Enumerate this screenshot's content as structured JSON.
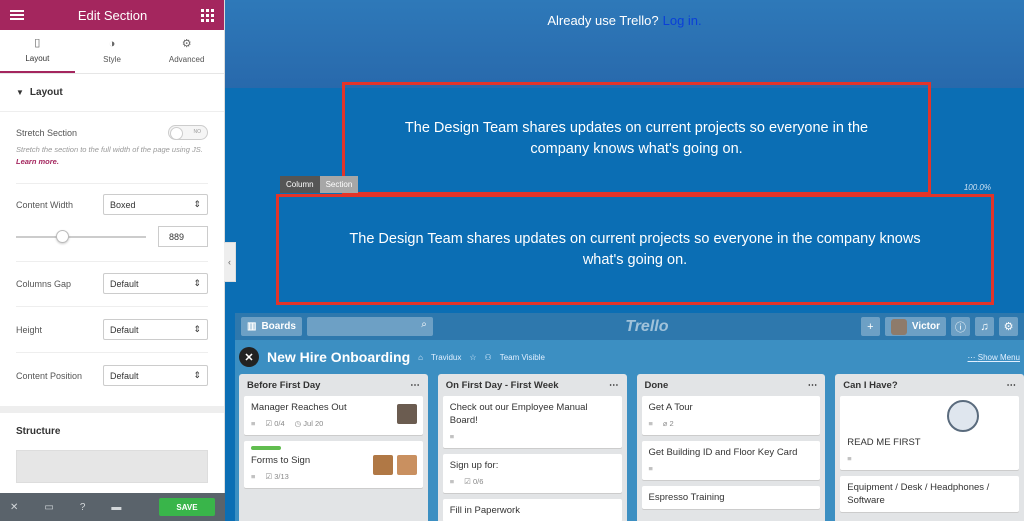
{
  "editor": {
    "title": "Edit Section",
    "tabs": [
      {
        "label": "Layout",
        "icon": "layout-icon"
      },
      {
        "label": "Style",
        "icon": "half-circle-icon"
      },
      {
        "label": "Advanced",
        "icon": "gear-icon"
      }
    ],
    "layout_section_title": "Layout",
    "stretch_label": "Stretch Section",
    "stretch_toggle": "NO",
    "stretch_hint": "Stretch the section to the full width of the page using JS.",
    "learn_more": "Learn more.",
    "content_width_label": "Content Width",
    "content_width_value": "Boxed",
    "slider_value": "889",
    "slider_fraction": 0.35,
    "columns_gap_label": "Columns Gap",
    "columns_gap_value": "Default",
    "height_label": "Height",
    "height_value": "Default",
    "content_position_label": "Content Position",
    "content_position_value": "Default",
    "structure_title": "Structure",
    "save_label": "SAVE"
  },
  "page": {
    "top_text": "Already use Trello?",
    "login_link": "Log in.",
    "text_block_1": "The Design Team shares updates on current projects so everyone in the company knows what's going on.",
    "text_block_2": "The Design Team shares updates on current projects so everyone in the company knows what's going on.",
    "column_badge": "Column",
    "section_badge": "Section",
    "width_percent": "100.0%",
    "accent_color": "#e3342a"
  },
  "trello": {
    "boards_label": "Boards",
    "logo": "Trello",
    "user": "Victor",
    "board_title": "New Hire Onboarding",
    "team": "Travidux",
    "visibility": "Team Visible",
    "show_menu": "Show Menu",
    "lists": [
      {
        "name": "Before First Day",
        "cards": [
          {
            "title": "Manager Reaches Out",
            "checklist": "0/4",
            "due": "Jul 20"
          },
          {
            "title": "Forms to Sign",
            "checklist": "3/13"
          }
        ]
      },
      {
        "name": "On First Day - First Week",
        "cards": [
          {
            "title": "Check out our Employee Manual Board!"
          },
          {
            "title": "Sign up for:",
            "checklist": "0/6"
          },
          {
            "title": "Fill in Paperwork"
          }
        ]
      },
      {
        "name": "Done",
        "cards": [
          {
            "title": "Get A Tour",
            "attachments": "2"
          },
          {
            "title": "Get Building ID and Floor Key Card"
          },
          {
            "title": "Espresso Training"
          }
        ]
      },
      {
        "name": "Can I Have?",
        "cards": [
          {
            "title": "READ ME FIRST"
          },
          {
            "title": "Equipment / Desk / Headphones / Software"
          }
        ]
      }
    ]
  }
}
